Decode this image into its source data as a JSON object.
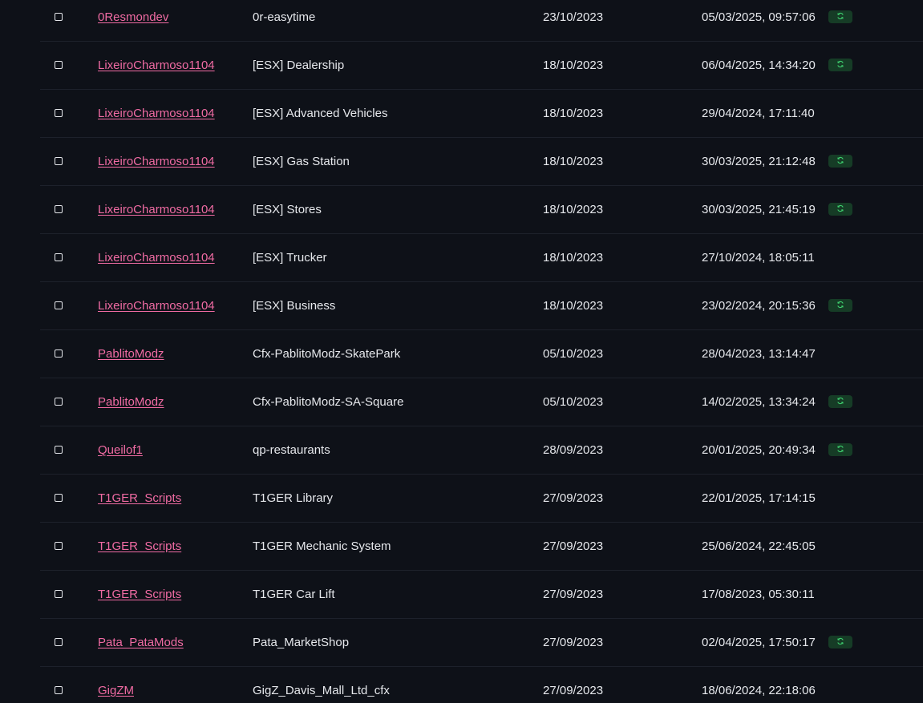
{
  "colors": {
    "background": "#0e1118",
    "row_divider": "#1d212b",
    "text": "#e6e8ec",
    "author_link": "#f06ba3",
    "badge_bg": "#163c26",
    "badge_icon": "#3ecf6e"
  },
  "icons": {
    "row_checkbox": "checkbox-icon",
    "update_badge": "refresh-icon"
  },
  "rows": [
    {
      "author": "0Resmondev",
      "name": "0r-easytime",
      "date": "23/10/2023",
      "updated": "05/03/2025, 09:57:06",
      "badge": true
    },
    {
      "author": "LixeiroCharmoso1104",
      "name": "[ESX] Dealership",
      "date": "18/10/2023",
      "updated": "06/04/2025, 14:34:20",
      "badge": true
    },
    {
      "author": "LixeiroCharmoso1104",
      "name": "[ESX] Advanced Vehicles",
      "date": "18/10/2023",
      "updated": "29/04/2024, 17:11:40",
      "badge": false
    },
    {
      "author": "LixeiroCharmoso1104",
      "name": "[ESX] Gas Station",
      "date": "18/10/2023",
      "updated": "30/03/2025, 21:12:48",
      "badge": true
    },
    {
      "author": "LixeiroCharmoso1104",
      "name": "[ESX] Stores",
      "date": "18/10/2023",
      "updated": "30/03/2025, 21:45:19",
      "badge": true
    },
    {
      "author": "LixeiroCharmoso1104",
      "name": "[ESX] Trucker",
      "date": "18/10/2023",
      "updated": "27/10/2024, 18:05:11",
      "badge": false
    },
    {
      "author": "LixeiroCharmoso1104",
      "name": "[ESX] Business",
      "date": "18/10/2023",
      "updated": "23/02/2024, 20:15:36",
      "badge": true
    },
    {
      "author": "PablitoModz",
      "name": "Cfx-PablitoModz-SkatePark",
      "date": "05/10/2023",
      "updated": "28/04/2023, 13:14:47",
      "badge": false
    },
    {
      "author": "PablitoModz",
      "name": "Cfx-PablitoModz-SA-Square",
      "date": "05/10/2023",
      "updated": "14/02/2025, 13:34:24",
      "badge": true
    },
    {
      "author": "Queilof1",
      "name": "qp-restaurants",
      "date": "28/09/2023",
      "updated": "20/01/2025, 20:49:34",
      "badge": true
    },
    {
      "author": "T1GER_Scripts",
      "name": "T1GER Library",
      "date": "27/09/2023",
      "updated": "22/01/2025, 17:14:15",
      "badge": false
    },
    {
      "author": "T1GER_Scripts",
      "name": "T1GER Mechanic System",
      "date": "27/09/2023",
      "updated": "25/06/2024, 22:45:05",
      "badge": false
    },
    {
      "author": "T1GER_Scripts",
      "name": "T1GER Car Lift",
      "date": "27/09/2023",
      "updated": "17/08/2023, 05:30:11",
      "badge": false
    },
    {
      "author": "Pata_PataMods",
      "name": "Pata_MarketShop",
      "date": "27/09/2023",
      "updated": "02/04/2025, 17:50:17",
      "badge": true
    },
    {
      "author": "GigZM",
      "name": "GigZ_Davis_Mall_Ltd_cfx",
      "date": "27/09/2023",
      "updated": "18/06/2024, 22:18:06",
      "badge": false
    }
  ]
}
